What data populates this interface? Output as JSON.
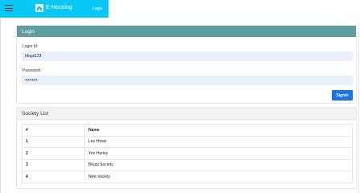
{
  "navbar": {
    "brand_name": "E-Housing",
    "login_link": "Login",
    "menu_icon": "hamburger-icon",
    "logo_icon": "house-logo-icon",
    "color": "#0ac8f5"
  },
  "login_card": {
    "title": "Login",
    "login_id_label": "Login Id:",
    "login_id_value": "bhupi123",
    "password_label": "Password:",
    "password_value": "•••••••••",
    "signin_label": "Signin",
    "header_color": "#5f9ea0",
    "button_color": "#1a73e8"
  },
  "society_list": {
    "title": "Society List",
    "columns": [
      "#",
      "Name"
    ],
    "rows": [
      {
        "num": "1",
        "name": "Leo Howe"
      },
      {
        "num": "2",
        "name": "Yen Hurley"
      },
      {
        "num": "3",
        "name": "Bhupi Society"
      },
      {
        "num": "4",
        "name": "New society"
      }
    ]
  }
}
